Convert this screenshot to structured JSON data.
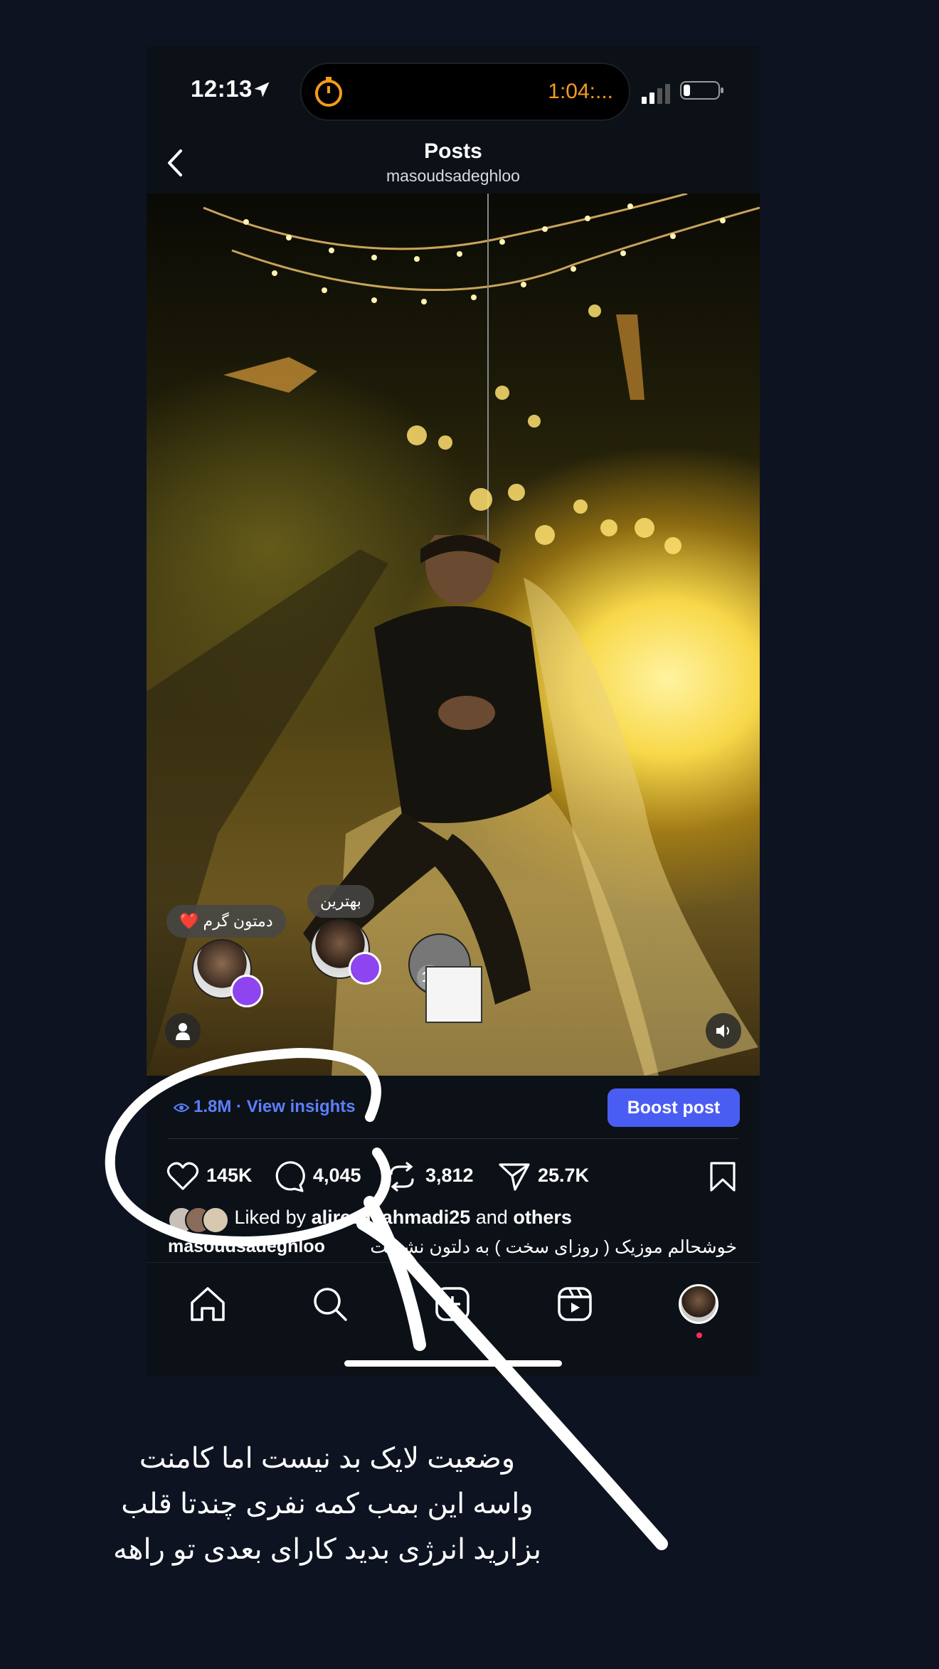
{
  "status_bar": {
    "time": "12:13",
    "island_timer": "1:04:..."
  },
  "header": {
    "title": "Posts",
    "username": "masoudsadeghloo"
  },
  "media": {
    "bubbles": [
      {
        "text": "دمتون گرم",
        "emoji": "❤️"
      },
      {
        "text": "بهترین"
      }
    ],
    "count_badge": "18"
  },
  "insights": {
    "views": "1.8M",
    "link": "View insights",
    "boost_label": "Boost post"
  },
  "actions": {
    "likes": "145K",
    "comments": "4,045",
    "reposts": "3,812",
    "shares": "25.7K"
  },
  "liked_by": {
    "prefix": "Liked by",
    "user": "alireza_ahmadi25",
    "and": "and",
    "others": "others"
  },
  "caption": {
    "user": "masoudsadeghloo",
    "text": "خوشحالم موزیک ( روزای سخت ) به دلتون نشست"
  },
  "annotation": {
    "lines": [
      "وضعیت لایک بد نیست اما کامنت",
      "واسه این بمب کمه نفری چندتا قلب",
      "بزارید انرژی بدید کارای بعدی تو راهه"
    ]
  },
  "colors": {
    "accent": "#4a5df3",
    "link": "#5b7fff",
    "timer": "#f39c1e",
    "repost": "#8e44ef"
  }
}
